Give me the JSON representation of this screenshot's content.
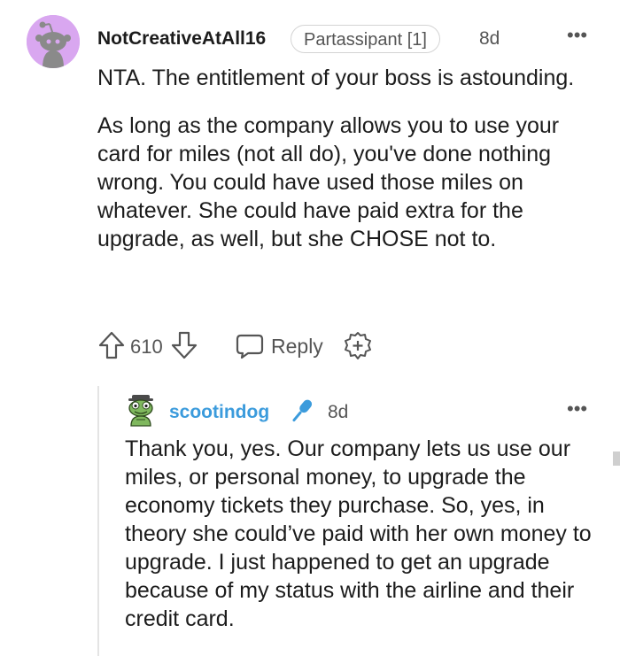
{
  "comment": {
    "username": "NotCreativeAtAll16",
    "flair": "Partassipant [1]",
    "time": "8d",
    "more_label": "•••",
    "paragraphs": [
      "NTA. The entitlement of your boss is astounding.",
      "As long as the company allows you to use your card for miles (not all do), you've done nothing wrong. You could have used those miles on whatever. She could have paid extra for the upgrade, as well, but she CHOSE not to."
    ],
    "score": "610",
    "reply_label": "Reply",
    "icons": {
      "avatar": "snoo-avatar-icon",
      "upvote": "upvote-arrow-icon",
      "downvote": "downvote-arrow-icon",
      "reply": "speech-bubble-icon",
      "award": "award-plus-icon",
      "more": "more-dots-icon"
    }
  },
  "reply": {
    "username": "scootindog",
    "time": "8d",
    "more_label": "•••",
    "text": "Thank you, yes. Our company lets us use our miles, or personal money, to upgrade the economy tickets they purchase. So, yes, in theory she could’ve paid with her own money to upgrade. I just happened to get an upgrade because of my status with the airline and their credit card.",
    "icons": {
      "avatar": "frog-avatar-icon",
      "op_badge": "microphone-icon",
      "more": "more-dots-icon"
    }
  },
  "colors": {
    "avatar_bg": "#d9a7f0",
    "username_link": "#3b9bdc",
    "secondary_text": "#555555",
    "thread_line": "#e4e4e4"
  }
}
